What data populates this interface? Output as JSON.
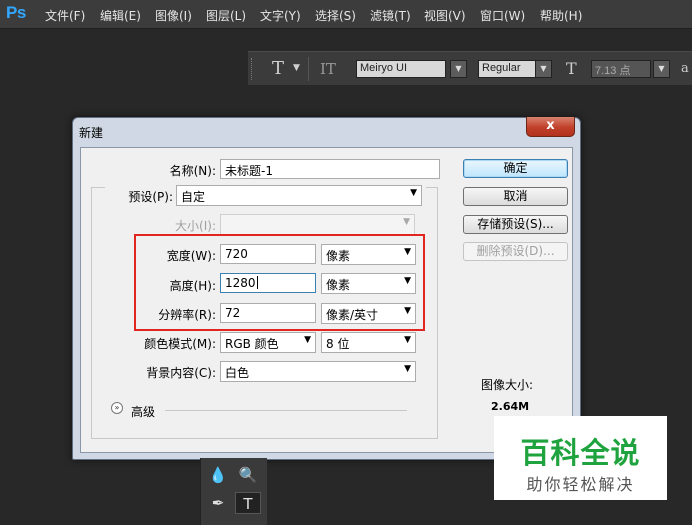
{
  "app": {
    "logo": "Ps"
  },
  "menubar": {
    "items": [
      "文件(F)",
      "编辑(E)",
      "图像(I)",
      "图层(L)",
      "文字(Y)",
      "选择(S)",
      "滤镜(T)",
      "视图(V)",
      "窗口(W)",
      "帮助(H)"
    ]
  },
  "options_bar": {
    "tool_glyph": "T",
    "orient_glyph": "IT",
    "font_family": "Meiryo UI",
    "font_style": "Regular",
    "size_glyph": "T",
    "font_size": "7.13 点",
    "extra_glyph": "a"
  },
  "dialog": {
    "title": "新建",
    "close_glyph": "x",
    "name_label": "名称(N):",
    "name_value": "未标题-1",
    "preset_label": "预设(P):",
    "preset_value": "自定",
    "size_label": "大小(I):",
    "size_value": "",
    "width_label": "宽度(W):",
    "width_value": "720",
    "width_unit": "像素",
    "height_label": "高度(H):",
    "height_value": "1280",
    "height_unit": "像素",
    "resolution_label": "分辨率(R):",
    "resolution_value": "72",
    "resolution_unit": "像素/英寸",
    "color_mode_label": "颜色模式(M):",
    "color_mode_value": "RGB 颜色",
    "bit_depth_value": "8 位",
    "background_label": "背景内容(C):",
    "background_value": "白色",
    "advanced_label": "高级",
    "image_size_label": "图像大小:",
    "image_size_value": "2.64M",
    "buttons": {
      "ok": "确定",
      "cancel": "取消",
      "save_preset": "存储预设(S)...",
      "delete_preset": "删除预设(D)..."
    }
  },
  "watermark": {
    "title": "百科全说",
    "subtitle": "助你轻松解决"
  },
  "colors": {
    "highlight_box": "#e0261f",
    "watermark_green": "#1fa33e",
    "ps_blue": "#31a8ff"
  }
}
